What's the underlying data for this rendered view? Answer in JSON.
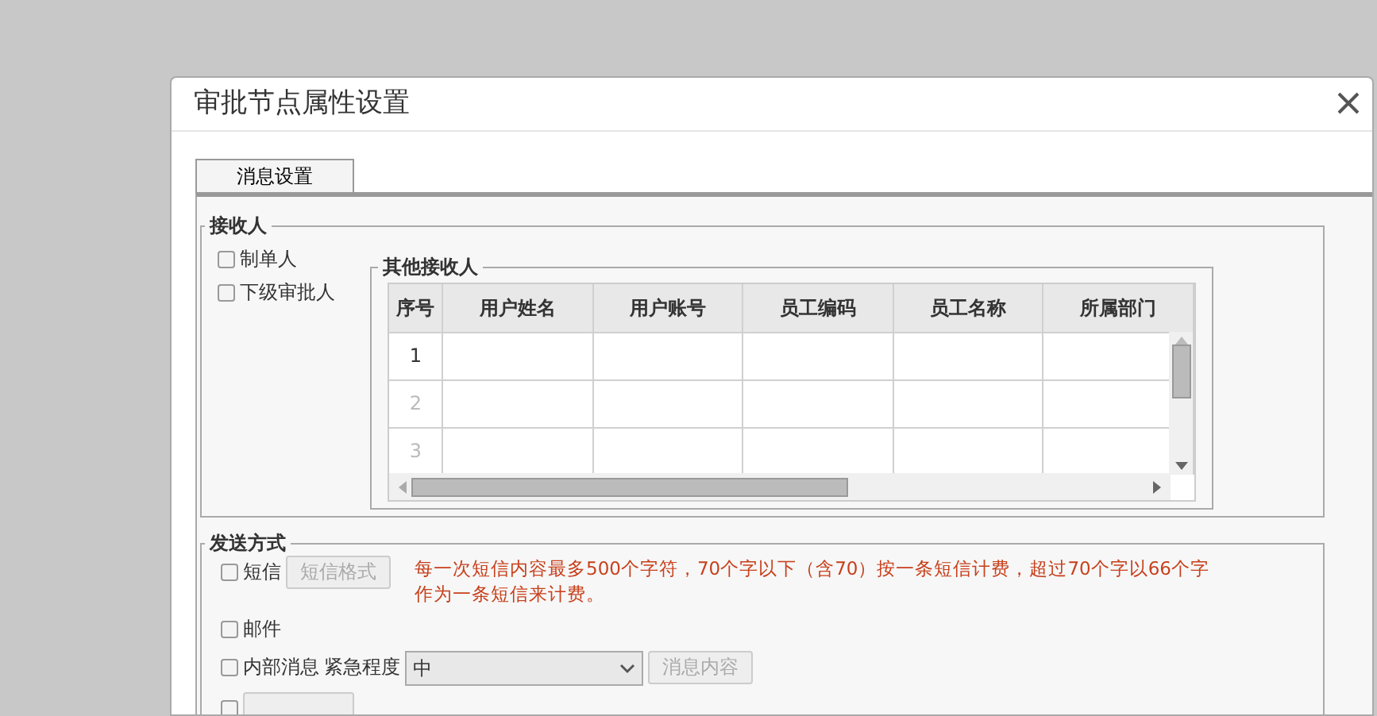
{
  "window": {
    "title": "审批节点属性设置"
  },
  "tabs": [
    {
      "label": "消息设置",
      "selected": true
    }
  ],
  "receivers": {
    "legend": "接收人",
    "options": [
      {
        "label": "制单人",
        "checked": false
      },
      {
        "label": "下级审批人",
        "checked": false
      }
    ],
    "others": {
      "legend": "其他接收人",
      "columns": [
        "序号",
        "用户姓名",
        "用户账号",
        "员工编码",
        "员工名称",
        "所属部门"
      ],
      "rows": [
        {
          "index": "1",
          "disabled": false
        },
        {
          "index": "2",
          "disabled": true
        },
        {
          "index": "3",
          "disabled": true
        }
      ]
    }
  },
  "send": {
    "legend": "发送方式",
    "methods": [
      {
        "kind": "button",
        "label": "短信",
        "checked": false,
        "button": "短信格式",
        "button_disabled": true,
        "note": "每一次短信内容最多500个字符，70个字以下（含70）按一条短信计费，超过70个字以66个字作为一条短信来计费。"
      },
      {
        "kind": "plain",
        "label": "邮件",
        "checked": false
      },
      {
        "kind": "select",
        "label": "内部消息",
        "checked": false,
        "select_label": "紧急程度",
        "select_value": "中",
        "button": "消息内容",
        "button_disabled": true
      },
      {
        "kind": "cut",
        "checked": false
      }
    ]
  }
}
